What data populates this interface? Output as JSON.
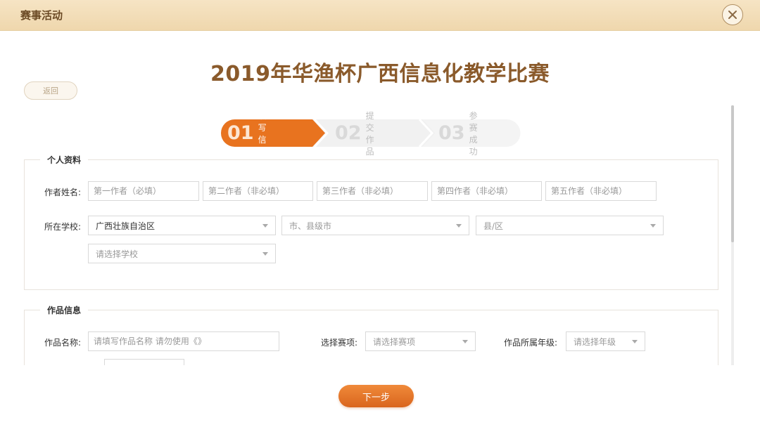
{
  "header": {
    "title": "赛事活动",
    "close_icon": "close-icon"
  },
  "page_title": "2019年华渔杯广西信息化教学比赛",
  "back_label": "返回",
  "steps": [
    {
      "num": "01",
      "label": "填写信息",
      "state": "active"
    },
    {
      "num": "02",
      "label": "提交作品",
      "state": "inactive"
    },
    {
      "num": "03",
      "label": "参赛成功",
      "state": "inactive"
    }
  ],
  "personal": {
    "legend": "个人资料",
    "author_label": "作者姓名:",
    "authors": [
      {
        "placeholder": "第一作者（必填）"
      },
      {
        "placeholder": "第二作者（非必填）"
      },
      {
        "placeholder": "第三作者（非必填）"
      },
      {
        "placeholder": "第四作者（非必填）"
      },
      {
        "placeholder": "第五作者（非必填）"
      }
    ],
    "school_label": "所在学校:",
    "province": "广西壮族自治区",
    "city": "市、县级市",
    "county": "县/区",
    "school": "请选择学校"
  },
  "work": {
    "legend": "作品信息",
    "name_label": "作品名称:",
    "name_placeholder": "请填写作品名称 请勿使用《》",
    "event_label": "选择赛项:",
    "event_placeholder": "请选择赛项",
    "grade_label": "作品所属年级:",
    "grade_placeholder": "请选择年级"
  },
  "next_label": "下一步",
  "colors": {
    "accent": "#e8731f",
    "brand_brown": "#8a5a2b",
    "step_inactive": "#f1f1f1"
  }
}
